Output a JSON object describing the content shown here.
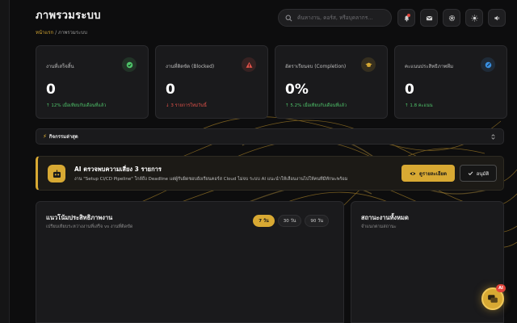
{
  "header": {
    "title": "ภาพรวมระบบ",
    "breadcrumb_home": "หน้าแรก",
    "breadcrumb_sep": " / ",
    "breadcrumb_current": "ภาพรวมระบบ"
  },
  "search": {
    "placeholder": "ค้นหางาน, คอร์ส, หรือบุคลากร..."
  },
  "toolbar": {
    "icons": [
      "bell-icon",
      "mail-icon",
      "gear-icon",
      "sun-icon",
      "speaker-icon"
    ]
  },
  "cards": [
    {
      "title": "งานที่เสร็จสิ้น",
      "value": "0",
      "trend": "↑ 12% เมื่อเทียบกับเดือนที่แล้ว",
      "trend_dir": "up",
      "icon": "check-circle-icon",
      "icon_color": "#4fc36a"
    },
    {
      "title": "งานที่ติดขัด (Blocked)",
      "value": "0",
      "trend": "↓ 3 รายการใหม่วันนี้",
      "trend_dir": "down",
      "icon": "warning-icon",
      "icon_color": "#e0524a"
    },
    {
      "title": "อัตราเรียนจบ (Completion)",
      "value": "0%",
      "trend": "↑ 5.2% เมื่อเทียบกับเดือนที่แล้ว",
      "trend_dir": "up",
      "icon": "graduation-cap-icon",
      "icon_color": "#d8a933"
    },
    {
      "title": "คะแนนประสิทธิภาพทีม",
      "value": "0",
      "trend": "↑ 1.8 คะแนน",
      "trend_dir": "up",
      "icon": "info-icon",
      "icon_color": "#3a8fe0"
    }
  ],
  "activity": {
    "label": "กิจกรรมล่าสุด"
  },
  "ai_alert": {
    "title": "AI ตรวจพบความเสี่ยง 3 รายการ",
    "description": "งาน \"Setup CI/CD Pipeline\" ใกล้ถึง Deadline แต่ผู้รับผิดชอบยังเรียนคอร์ส Cloud ไม่จบ ระบบ AI แนะนำให้เลื่อนงานไปให้คนที่มีทักษะพร้อม",
    "details_button": "ดูรายละเอียด",
    "approve_button": "อนุมัติ"
  },
  "performance_panel": {
    "title": "แนวโน้มประสิทธิภาพงาน",
    "subtitle": "เปรียบเทียบระหว่างงานที่เสร็จ vs งานที่ติดขัด",
    "ranges": [
      "7 วัน",
      "30 วัน",
      "90 วัน"
    ],
    "active_range": "7 วัน"
  },
  "status_panel": {
    "title": "สถานะงานทั้งหมด",
    "subtitle": "จำแนกตามสถานะ"
  },
  "fab": {
    "badge": "AI"
  },
  "colors": {
    "accent": "#d8a933",
    "success": "#4fc36a",
    "danger": "#e0524a",
    "info": "#3a8fe0",
    "background": "#0d0d0e"
  }
}
